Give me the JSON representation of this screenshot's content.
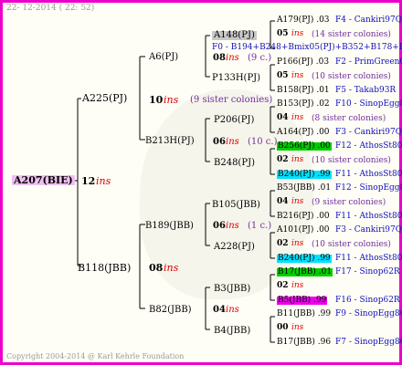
{
  "date": "22- 12-2014 ( 22: 52)",
  "copyright": "Copyright 2004-2014 @ Karl Kehrle Foundation",
  "colors": {
    "border": "#ee00cc",
    "root_bg": "#eec0f0",
    "grey_bg": "#c8c8c8",
    "green_bg": "#00cc00",
    "cyan_bg": "#00e0ff",
    "magenta_bg": "#ee00ee"
  },
  "root": {
    "name": "A207(BIE)",
    "gen": "12",
    "ins": "ins"
  },
  "gen1": {
    "a225": {
      "name": "A225(PJ)",
      "gen": "10",
      "ins": "ins",
      "sisters": "(9 sister colonies)"
    },
    "b118": {
      "name": "B118(JBB)",
      "gen": "08",
      "ins": "ins"
    }
  },
  "gen2": {
    "a6": {
      "name": "A6(PJ)"
    },
    "b213h": {
      "name": "B213H(PJ)"
    },
    "b189": {
      "name": "B189(JBB)"
    },
    "b82": {
      "name": "B82(JBB)"
    }
  },
  "gen3": {
    "a148": {
      "name": "A148(PJ)",
      "gen": "08",
      "ins": "ins",
      "sisters": "(9 c.)",
      "overlap": "F0 - B194+B248+Bmix05(PJ)+B352+B178+B354"
    },
    "p133h": {
      "name": "P133H(PJ)"
    },
    "p206": {
      "name": "P206(PJ)",
      "gen": "06",
      "ins": "ins",
      "sisters": "(10 c.)"
    },
    "b248": {
      "name": "B248(PJ)"
    },
    "b105": {
      "name": "B105(JBB)",
      "gen": "06",
      "ins": "ins",
      "sisters": "(1 c.)"
    },
    "a228": {
      "name": "A228(PJ)"
    },
    "b3": {
      "name": "B3(JBB)",
      "gen": "04",
      "ins": "ins"
    },
    "b4": {
      "name": "B4(JBB)"
    }
  },
  "gen4": [
    {
      "top": "A179(PJ) .03",
      "top_src": "F4 - Cankiri97Q",
      "gen": "05",
      "ins": "ins",
      "sisters": "(14 sister colonies)",
      "bot": "",
      "bot_src": ""
    },
    {
      "top": "P166(PJ) .03",
      "top_src": "F2 - PrimGreen00",
      "gen": "05",
      "ins": "ins",
      "sisters": "(10 sister colonies)",
      "bot": "B158(PJ) .01",
      "bot_src": "F5 - Takab93R"
    },
    {
      "top": "B153(PJ) .02",
      "top_src": "F10 - SinopEgg86R",
      "gen": "04",
      "ins": "ins",
      "sisters": "(8 sister colonies)",
      "bot": "A164(PJ) .00",
      "bot_src": "F3 - Cankiri97Q"
    },
    {
      "top": "B256(PJ) .00",
      "top_src": "F12 - AthosSt80R",
      "gen": "02",
      "ins": "ins",
      "sisters": "(10 sister colonies)",
      "bot": "B240(PJ) .99",
      "bot_src": "F11 - AthosSt80R"
    },
    {
      "top": "B53(JBB) .01",
      "top_src": "F12 - SinopEgg86R",
      "gen": "04",
      "ins": "ins",
      "sisters": "(9 sister colonies)",
      "bot": "B216(PJ) .00",
      "bot_src": "F11 - AthosSt80R"
    },
    {
      "top": "A101(PJ) .00",
      "top_src": "F3 - Cankiri97Q",
      "gen": "02",
      "ins": "ins",
      "sisters": "(10 sister colonies)",
      "bot": "B240(PJ) .99",
      "bot_src": "F11 - AthosSt80R"
    },
    {
      "top": "B17(JBB) .01",
      "top_src": "F17 - Sinop62R",
      "gen": "02",
      "ins": "ins",
      "sisters": "",
      "bot": "B5(JBB) .99",
      "bot_src": "F16 - Sinop62R"
    },
    {
      "top": "B11(JBB) .99",
      "top_src": "F9 - SinopEgg86R",
      "gen": "00",
      "ins": "ins",
      "sisters": "",
      "bot": "B17(JBB) .96",
      "bot_src": "F7 - SinopEgg86R"
    }
  ]
}
